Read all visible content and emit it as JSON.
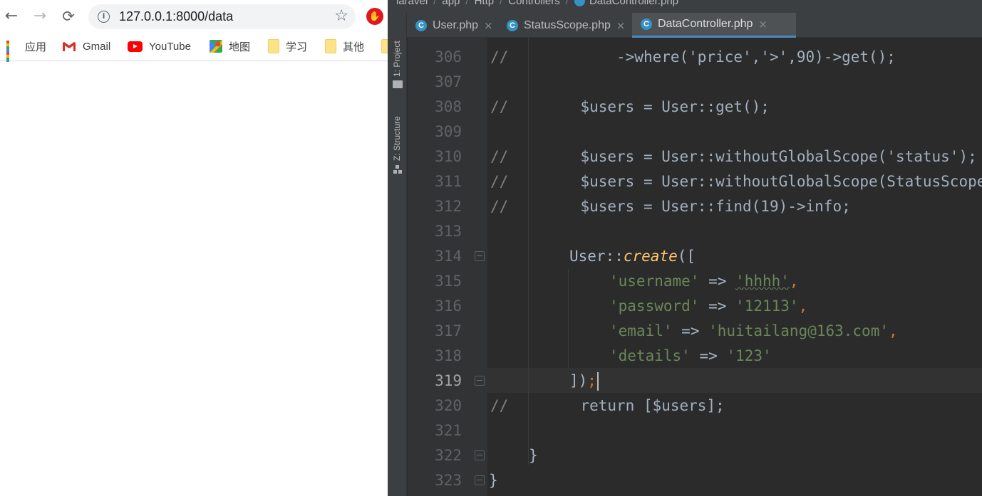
{
  "browser": {
    "url": "127.0.0.1:8000/data",
    "bookmarks": [
      {
        "label": "应用",
        "icon": "apps-grid-icon"
      },
      {
        "label": "Gmail",
        "icon": "gmail-icon"
      },
      {
        "label": "YouTube",
        "icon": "youtube-icon"
      },
      {
        "label": "地图",
        "icon": "maps-icon"
      },
      {
        "label": "学习",
        "icon": "folder-icon"
      },
      {
        "label": "其他",
        "icon": "folder-icon"
      }
    ],
    "icons": {
      "back": "←",
      "forward": "→",
      "reload": "⟳",
      "star": "☆",
      "info": "i"
    }
  },
  "ide": {
    "breadcrumb": [
      "laravel",
      "app",
      "Http",
      "Controllers",
      "DataController.php"
    ],
    "side_panels": [
      "1: Project",
      "Z: Structure"
    ],
    "tabs": [
      {
        "label": "User.php",
        "active": false
      },
      {
        "label": "StatusScope.php",
        "active": false
      },
      {
        "label": "DataController.php",
        "active": true
      }
    ],
    "tab_close_glyph": "×",
    "file_icon_letter": "C",
    "current_line": 319,
    "lines": [
      {
        "n": "306",
        "comment": "//",
        "code": "            ->where('price','>',90)->get();"
      },
      {
        "n": "307",
        "comment": "",
        "code": ""
      },
      {
        "n": "308",
        "comment": "//",
        "code": "        $users = User::get();"
      },
      {
        "n": "309",
        "comment": "",
        "code": ""
      },
      {
        "n": "310",
        "comment": "//",
        "code": "        $users = User::withoutGlobalScope('status');"
      },
      {
        "n": "311",
        "comment": "//",
        "code": "        $users = User::withoutGlobalScope(StatusScope::class);"
      },
      {
        "n": "312",
        "comment": "//",
        "code": "        $users = User::find(19)->info;"
      },
      {
        "n": "313",
        "comment": "",
        "code": ""
      },
      {
        "n": "314",
        "comment": "",
        "code": "User::create(["
      },
      {
        "n": "315",
        "comment": "",
        "code": "'username' => 'hhhh',"
      },
      {
        "n": "316",
        "comment": "",
        "code": "'password' => '12113',"
      },
      {
        "n": "317",
        "comment": "",
        "code": "'email' => 'huitailang@163.com',"
      },
      {
        "n": "318",
        "comment": "",
        "code": "'details' => '123'"
      },
      {
        "n": "319",
        "comment": "",
        "code": "]);"
      },
      {
        "n": "320",
        "comment": "//",
        "code": "        return [$users];"
      },
      {
        "n": "321",
        "comment": "",
        "code": ""
      },
      {
        "n": "322",
        "comment": "",
        "code": "}"
      },
      {
        "n": "323",
        "comment": "",
        "code": "}"
      }
    ],
    "tokens": {
      "create_class": "User",
      "create_sep": "::",
      "create_method": "create",
      "create_open": "([",
      "arrow": "=>",
      "comma": ",",
      "username_key": "'username'",
      "username_val": "'hhhh'",
      "password_key": "'password'",
      "password_val": "'12113'",
      "email_key": "'email'",
      "email_val": "'huitailang@163.com'",
      "details_key": "'details'",
      "details_val": "'123'",
      "close_bracket": "])",
      "semicolon": ";",
      "brace": "}"
    },
    "colors": {
      "keyword": "#cc7832",
      "string": "#6a8759",
      "comment": "#808080",
      "function": "#ffc66d",
      "text": "#a9b7c6",
      "accent": "#4a88c7"
    }
  }
}
